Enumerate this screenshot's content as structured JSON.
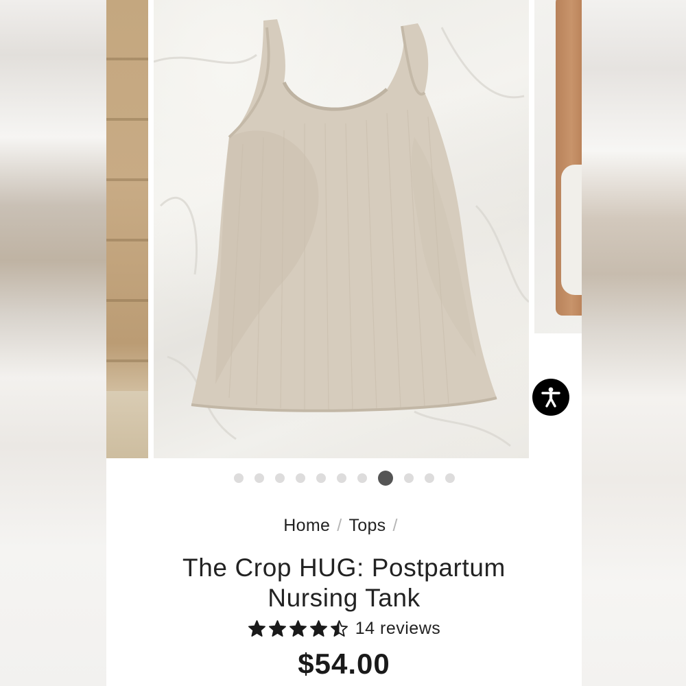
{
  "gallery": {
    "slide_count": 11,
    "active_index": 7,
    "main_image_alt": "Product photo: beige ribbed racerback tank top laid on white sheet"
  },
  "breadcrumb": {
    "items": [
      "Home",
      "Tops"
    ],
    "separator": "/"
  },
  "product": {
    "title_line1": "The Crop HUG: Postpartum",
    "title_line2": "Nursing Tank",
    "rating": 4.5,
    "reviews_label": "14 reviews",
    "price": "$54.00"
  },
  "icons": {
    "accessibility": "accessibility-icon",
    "star": "star-icon"
  },
  "colors": {
    "dot_active": "#555555",
    "dot_inactive": "#dddcdc",
    "text": "#222222",
    "a11y_button": "#000000"
  }
}
